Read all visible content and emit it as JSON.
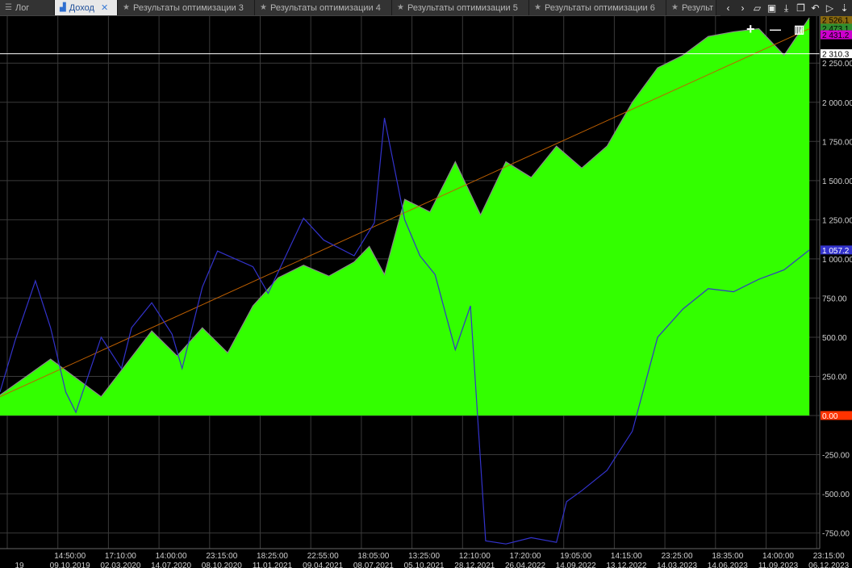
{
  "tabs": [
    {
      "label": "Лог",
      "icon": "list-icon",
      "active": false
    },
    {
      "label": "Доход",
      "icon": "chart-icon",
      "active": true
    },
    {
      "label": "Результаты оптимизации 3",
      "icon": "star-icon",
      "active": false
    },
    {
      "label": "Результаты оптимизации 4",
      "icon": "star-icon",
      "active": false
    },
    {
      "label": "Результаты оптимизации 5",
      "icon": "star-icon",
      "active": false
    },
    {
      "label": "Результаты оптимизации 6",
      "icon": "star-icon",
      "active": false
    },
    {
      "label": "Результ",
      "icon": "star-icon",
      "active": false
    }
  ],
  "toolbar": {
    "icons": [
      "chevron-left-icon",
      "chevron-right-icon",
      "folder-open-icon",
      "save-icon",
      "download-icon",
      "copy-icon",
      "undo-icon",
      "play-icon",
      "arrow-down-icon"
    ],
    "glyphs": [
      "‹",
      "›",
      "▱",
      "▣",
      "⤓",
      "❐",
      "↶",
      "▷",
      "⇣"
    ]
  },
  "zoom": {
    "plus": "+",
    "minus": "—",
    "fit": "▥"
  },
  "colors": {
    "background": "#000000",
    "grid": "#3a3a3a",
    "area": "#33ff00",
    "balance_line": "#8a8a8a",
    "benchmark_line": "#3333cc",
    "trend_line": "#c06000",
    "reference_line": "#ffffff"
  },
  "chart_data": {
    "type": "area",
    "title": "",
    "ylim": [
      -850,
      2550
    ],
    "y_ticks": [
      {
        "value": 2250,
        "label": "2 250.00"
      },
      {
        "value": 2000,
        "label": "2 000.00"
      },
      {
        "value": 1750,
        "label": "1 750.00"
      },
      {
        "value": 1500,
        "label": "1 500.00"
      },
      {
        "value": 1250,
        "label": "1 250.00"
      },
      {
        "value": 1000,
        "label": "1 000.00"
      },
      {
        "value": 750,
        "label": "750.00"
      },
      {
        "value": 500,
        "label": "500.00"
      },
      {
        "value": 250,
        "label": "250.00"
      },
      {
        "value": -250,
        "label": "-250.00"
      },
      {
        "value": -500,
        "label": "-500.00"
      },
      {
        "value": -750,
        "label": "-750.00"
      }
    ],
    "x_ticks": [
      {
        "time": "",
        "date": "19"
      },
      {
        "time": "14:50:00",
        "date": "09.10.2019"
      },
      {
        "time": "17:10:00",
        "date": "02.03.2020"
      },
      {
        "time": "14:00:00",
        "date": "14.07.2020"
      },
      {
        "time": "23:15:00",
        "date": "08.10.2020"
      },
      {
        "time": "18:25:00",
        "date": "11.01.2021"
      },
      {
        "time": "22:55:00",
        "date": "09.04.2021"
      },
      {
        "time": "18:05:00",
        "date": "08.07.2021"
      },
      {
        "time": "13:25:00",
        "date": "05.10.2021"
      },
      {
        "time": "12:10:00",
        "date": "28.12.2021"
      },
      {
        "time": "17:20:00",
        "date": "26.04.2022"
      },
      {
        "time": "19:05:00",
        "date": "14.09.2022"
      },
      {
        "time": "14:15:00",
        "date": "13.12.2022"
      },
      {
        "time": "23:25:00",
        "date": "14.03.2023"
      },
      {
        "time": "18:35:00",
        "date": "14.06.2023"
      },
      {
        "time": "14:00:00",
        "date": "11.09.2023"
      },
      {
        "time": "23:15:00",
        "date": "06.12.2023"
      }
    ],
    "price_tags": [
      {
        "label": "2 526.1",
        "value": 2526,
        "color": "#8a6a10",
        "text": "#000000"
      },
      {
        "label": "2 473.1",
        "value": 2473,
        "color": "#2f8f2f",
        "text": "#000000"
      },
      {
        "label": "2 431.2",
        "value": 2431,
        "color": "#cc00cc",
        "text": "#000000"
      },
      {
        "label": "2 310.3",
        "value": 2310,
        "color": "#ffffff",
        "text": "#000000"
      },
      {
        "label": "1 057.2",
        "value": 1057,
        "color": "#3333cc",
        "text": "#ffffff"
      },
      {
        "label": "0.00",
        "value": 0,
        "color": "#ff3300",
        "text": "#ffffff"
      }
    ],
    "trend": {
      "start": 120,
      "end": 2470
    },
    "reference_level": 2310,
    "series": [
      {
        "kind": "area",
        "x": [
          0,
          1,
          2,
          3,
          3.5,
          4,
          4.5,
          5,
          5.5,
          6,
          6.5,
          7,
          7.3,
          7.6,
          8,
          8.5,
          9,
          9.5,
          10,
          10.5,
          11,
          11.5,
          12,
          12.5,
          13,
          13.5,
          14,
          14.5,
          15,
          15.5,
          16
        ],
        "values": [
          130,
          360,
          120,
          540,
          380,
          560,
          400,
          700,
          880,
          960,
          890,
          980,
          1080,
          900,
          1380,
          1300,
          1620,
          1280,
          1620,
          1520,
          1720,
          1580,
          1720,
          2000,
          2220,
          2300,
          2420,
          2450,
          2470,
          2300,
          2540
        ]
      },
      {
        "kind": "line",
        "x": [
          0,
          0.3,
          0.7,
          1,
          1.3,
          1.5,
          2,
          2.4,
          2.6,
          3,
          3.4,
          3.6,
          4,
          4.3,
          5,
          5.3,
          6,
          6.4,
          7,
          7.4,
          7.6,
          8,
          8.3,
          8.6,
          9,
          9.3,
          9.6,
          10,
          10.5,
          11,
          11.2,
          11.5,
          12,
          12.5,
          13,
          13.5,
          14,
          14.5,
          15,
          15.5,
          16
        ],
        "values": [
          150,
          480,
          860,
          560,
          150,
          20,
          500,
          300,
          560,
          720,
          520,
          300,
          820,
          1050,
          950,
          780,
          1260,
          1120,
          1020,
          1230,
          1900,
          1250,
          1020,
          900,
          420,
          700,
          -800,
          -820,
          -780,
          -810,
          -550,
          -480,
          -350,
          -100,
          500,
          680,
          810,
          790,
          870,
          930,
          1057
        ]
      }
    ]
  }
}
